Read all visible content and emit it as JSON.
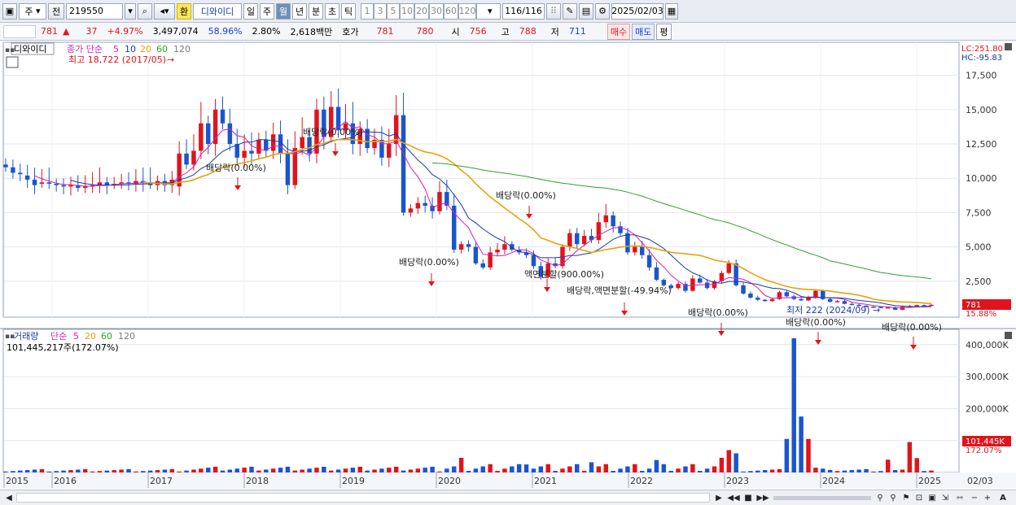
{
  "toolbar": {
    "market": "주",
    "prev_label": "전",
    "code": "219550",
    "currency_badge": "환",
    "stock_name": "디와이디",
    "periods": [
      "일",
      "주",
      "월",
      "년",
      "분",
      "초",
      "틱"
    ],
    "active_period": "월",
    "intervals": [
      "1",
      "3",
      "5",
      "10",
      "20",
      "30",
      "60",
      "120"
    ],
    "page_count": "116/116",
    "date": "2025/02/03"
  },
  "quote": {
    "price": "781",
    "direction": "▲",
    "change": "37",
    "change_pct": "+4.97%",
    "volume": "3,497,074",
    "volume_pct": "58.96%",
    "turnover": "2.80%",
    "amount": "2,618백만",
    "bid_label": "호가",
    "ask": "781",
    "bid": "780",
    "open_label": "시",
    "open": "756",
    "high_label": "고",
    "high": "788",
    "low_label": "저",
    "low": "711",
    "buy_label": "매수",
    "sell_label": "매도",
    "avg_label": "평"
  },
  "price_panel": {
    "title": "디와이디",
    "legend_label": "종가 단순",
    "ma_periods": [
      "5",
      "10",
      "20",
      "60",
      "120"
    ],
    "max_label": "최고 18,722 (2017/05)",
    "min_label": "최저 222 (2024/09)",
    "lc": "LC:251.80",
    "hc": "HC:-95.83",
    "last_price_tag": "781",
    "last_pct_tag": "15.88%",
    "events": [
      {
        "label": "배당락(0.00%)",
        "x": "2017-09"
      },
      {
        "label": "배당락(0.00%)",
        "x": "2018-12"
      },
      {
        "label": "배당락(0.00%)",
        "x": "2020-12"
      },
      {
        "label": "배당락(0.00%)",
        "x": "2019-12"
      },
      {
        "label": "액면분할(900.00%)",
        "x": "2021-04"
      },
      {
        "label": "배당락,액면분할(-49.94%)",
        "x": "2021-12"
      },
      {
        "label": "배당락(0.00%)",
        "x": "2022-12"
      },
      {
        "label": "배당락(0.00%)",
        "x": "2023-12"
      },
      {
        "label": "배당락(0.00%)",
        "x": "2024-12"
      }
    ]
  },
  "volume_panel": {
    "title": "거래량",
    "legend_label": "단순",
    "ma_periods": [
      "5",
      "20",
      "60",
      "120"
    ],
    "current_label": "101,445,217주(172.07%)",
    "last_vol_tag": "101,445K",
    "last_pct_tag": "172.07%"
  },
  "x_axis": {
    "labels": [
      "2015",
      "2016",
      "2017",
      "2018",
      "2019",
      "2020",
      "2021",
      "2022",
      "2023",
      "2024",
      "2025"
    ],
    "end_label": "02/03"
  },
  "colors": {
    "up": "#e0141c",
    "down": "#1a55d0",
    "ma5": "#d61fb4",
    "ma10": "#1a3aa8",
    "ma20": "#e8a20c",
    "ma60": "#2ea02e",
    "ma120": "#7a7a7a"
  },
  "chart_data": {
    "type": "candlestick",
    "price_axis": {
      "ticks": [
        "17,500",
        "15,000",
        "12,500",
        "10,000",
        "7,500",
        "5,000",
        "2,500"
      ],
      "ylim": [
        0,
        18722
      ]
    },
    "volume_axis": {
      "ticks": [
        "400,000K",
        "300,000K",
        "200,000K",
        "100,000K"
      ],
      "ylim": [
        0,
        430000
      ]
    }
  }
}
